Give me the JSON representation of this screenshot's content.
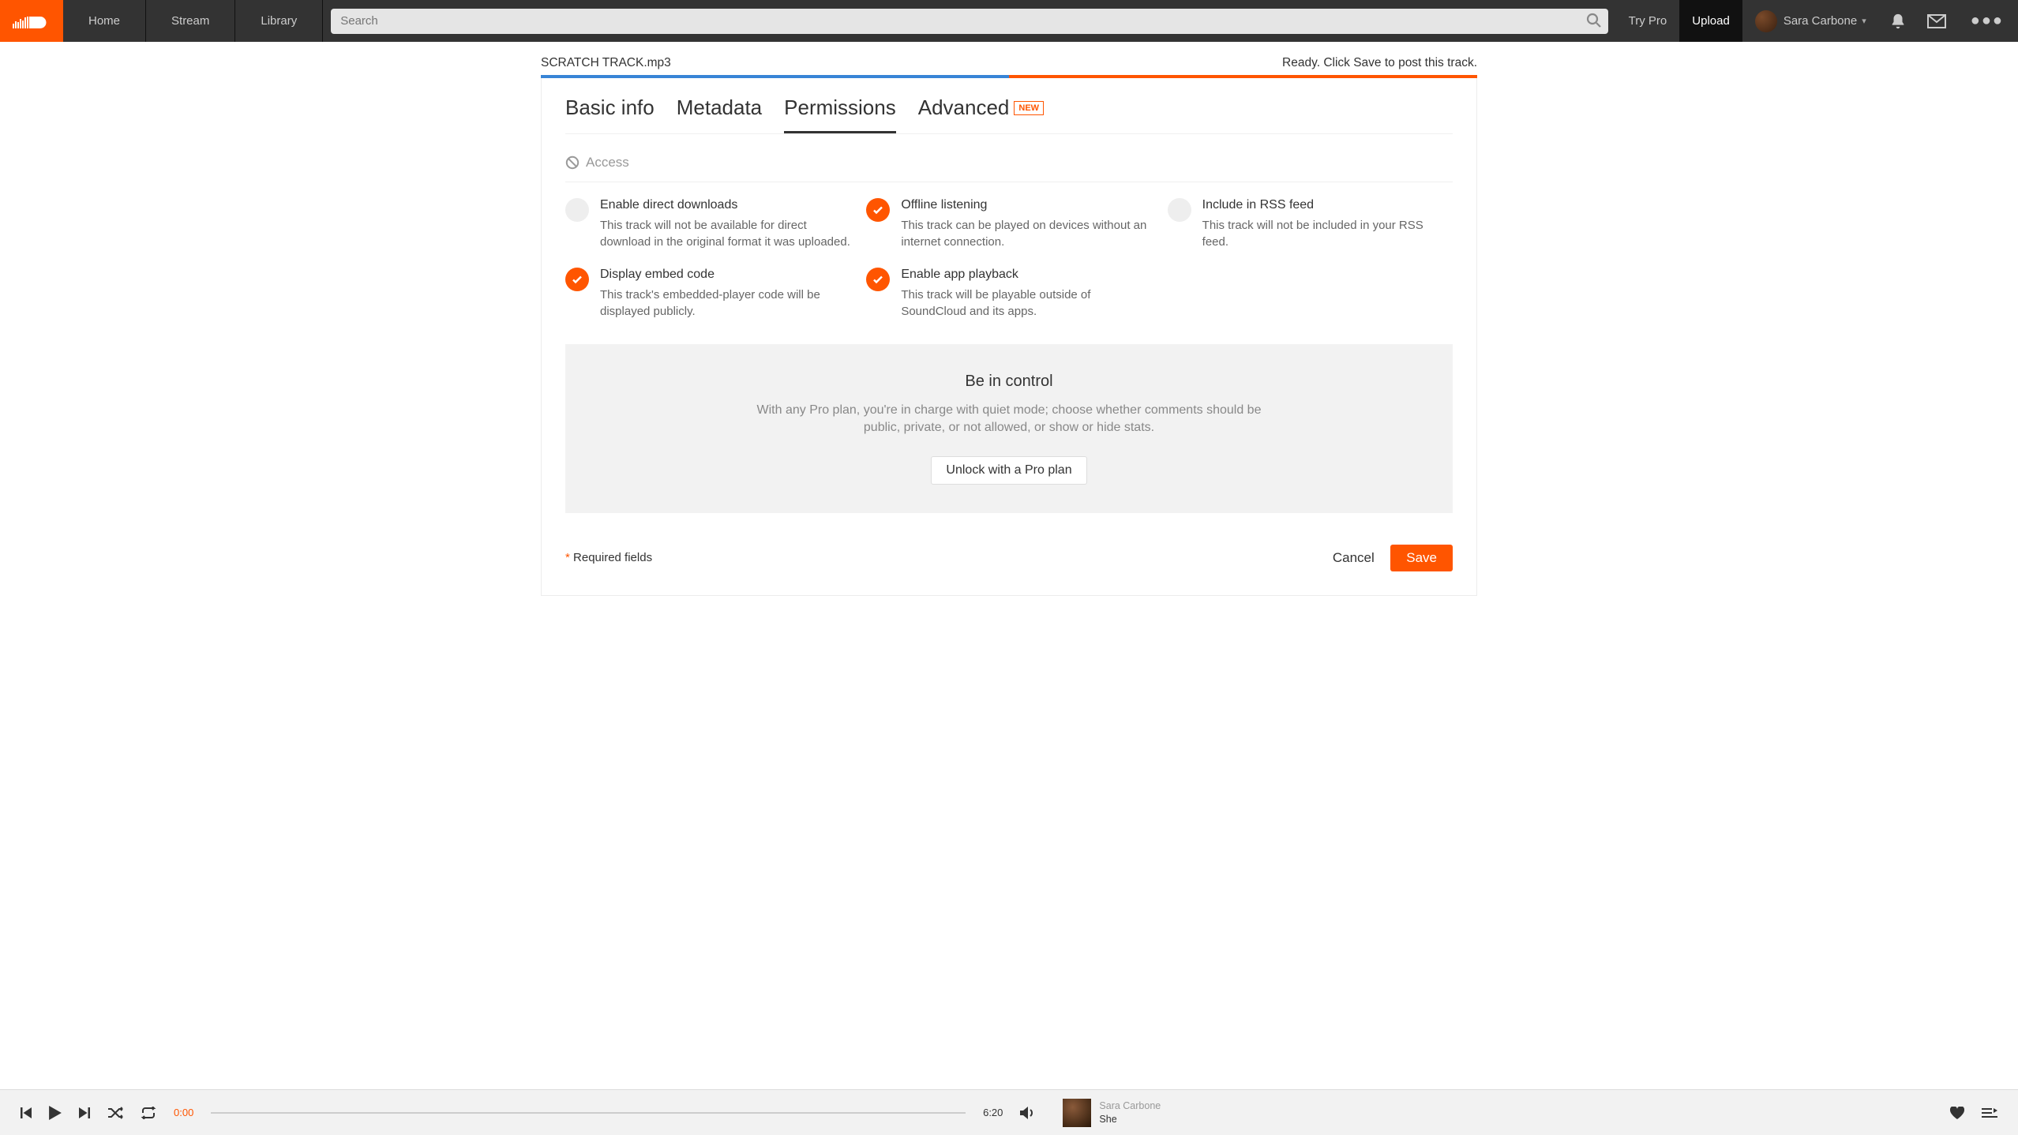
{
  "nav": {
    "home": "Home",
    "stream": "Stream",
    "library": "Library",
    "search_placeholder": "Search",
    "try_pro": "Try Pro",
    "upload": "Upload",
    "user_name": "Sara Carbone"
  },
  "upload": {
    "filename": "SCRATCH TRACK.mp3",
    "status": "Ready. Click Save to post this track."
  },
  "tabs": {
    "basic": "Basic info",
    "metadata": "Metadata",
    "permissions": "Permissions",
    "advanced": "Advanced",
    "new_badge": "NEW"
  },
  "access": {
    "heading": "Access",
    "items": [
      {
        "title": "Enable direct downloads",
        "desc": "This track will not be available for direct download in the original format it was uploaded.",
        "on": false
      },
      {
        "title": "Offline listening",
        "desc": "This track can be played on devices without an internet connection.",
        "on": true
      },
      {
        "title": "Include in RSS feed",
        "desc": "This track will not be included in your RSS feed.",
        "on": false
      },
      {
        "title": "Display embed code",
        "desc": "This track's embedded-player code will be displayed publicly.",
        "on": true
      },
      {
        "title": "Enable app playback",
        "desc": "This track will be playable outside of SoundCloud and its apps.",
        "on": true
      }
    ]
  },
  "promo": {
    "title": "Be in control",
    "text": "With any Pro plan, you're in charge with quiet mode; choose whether comments should be public, private, or not allowed, or show or hide stats.",
    "button": "Unlock with a Pro plan"
  },
  "footer": {
    "required": "Required fields",
    "cancel": "Cancel",
    "save": "Save"
  },
  "player": {
    "current_time": "0:00",
    "duration": "6:20",
    "artist": "Sara Carbone",
    "title": "She"
  }
}
